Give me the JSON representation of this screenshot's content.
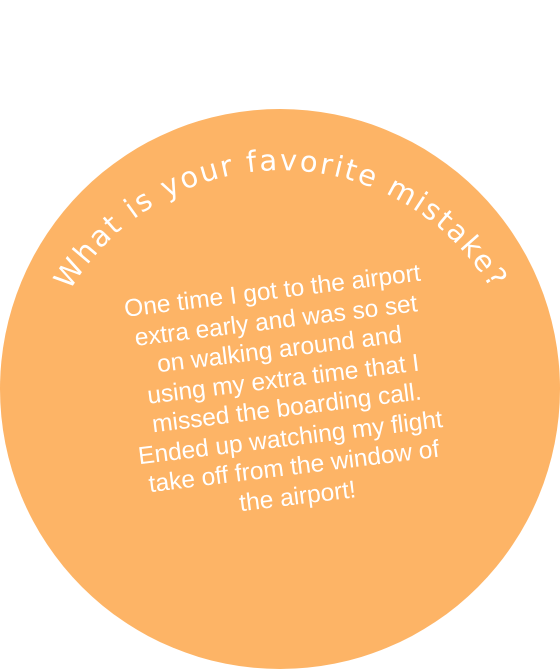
{
  "card": {
    "question": "What is your favorite mistake?",
    "answer_lines": [
      "One time I got to the airport",
      "extra early and was so set",
      "on walking around and",
      "using my extra time that I",
      "missed the boarding call.",
      "Ended up watching my flight",
      "take off from the window of",
      "the airport!"
    ]
  },
  "colors": {
    "background": "#ffffff",
    "disc": "#fdb466",
    "text": "#ffffff"
  }
}
